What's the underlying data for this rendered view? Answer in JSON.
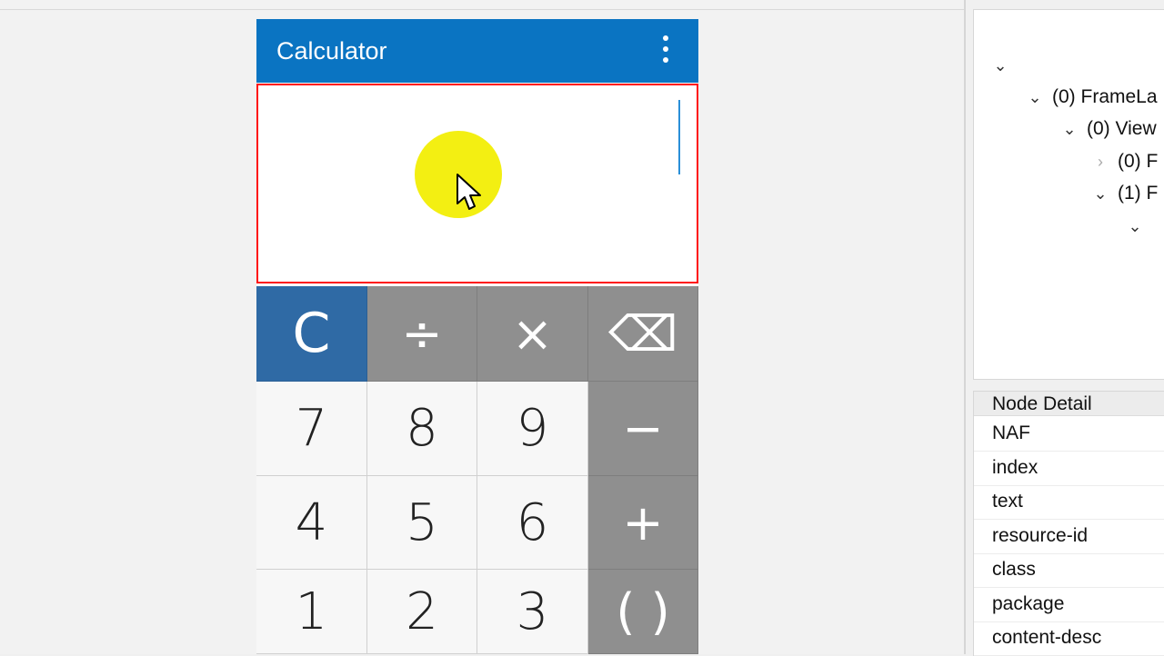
{
  "app": {
    "title": "Calculator",
    "menu_icon": "overflow-menu-icon"
  },
  "display": {
    "value": "",
    "border_color": "#ff1010"
  },
  "keypad": {
    "rows": [
      [
        {
          "label": "C",
          "type": "clear"
        },
        {
          "label": "÷",
          "type": "op"
        },
        {
          "label": "×",
          "type": "op"
        },
        {
          "label": "⌫",
          "type": "op",
          "icon": "backspace-icon"
        }
      ],
      [
        {
          "label": "7",
          "type": "num"
        },
        {
          "label": "8",
          "type": "num"
        },
        {
          "label": "9",
          "type": "num"
        },
        {
          "label": "−",
          "type": "op"
        }
      ],
      [
        {
          "label": "4",
          "type": "num"
        },
        {
          "label": "5",
          "type": "num"
        },
        {
          "label": "6",
          "type": "num"
        },
        {
          "label": "+",
          "type": "op"
        }
      ],
      [
        {
          "label": "1",
          "type": "num"
        },
        {
          "label": "2",
          "type": "num"
        },
        {
          "label": "3",
          "type": "num"
        },
        {
          "label": "( )",
          "type": "op"
        }
      ]
    ]
  },
  "tree": {
    "nodes": [
      {
        "label": "",
        "expander": "down"
      },
      {
        "label": "(0) FrameLa",
        "expander": "down"
      },
      {
        "label": "(0) View",
        "expander": "down"
      },
      {
        "label": "(0) F",
        "expander": "right"
      },
      {
        "label": "(1) F",
        "expander": "down"
      },
      {
        "label": "",
        "expander": "down"
      }
    ]
  },
  "node_detail": {
    "title": "Node Detail",
    "fields": [
      "NAF",
      "index",
      "text",
      "resource-id",
      "class",
      "package",
      "content-desc"
    ]
  },
  "colors": {
    "app_bar": "#0a74c2",
    "clear_key": "#2f6aa5",
    "operator_key": "#8f8f8f",
    "highlight": "#f3ef12"
  }
}
